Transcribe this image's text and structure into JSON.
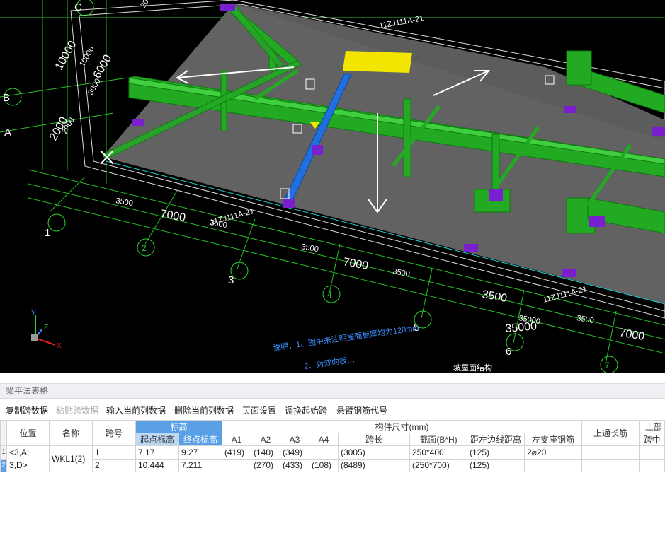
{
  "viewport": {
    "axis_letters": [
      "C",
      "B",
      "A"
    ],
    "axis_numbers": [
      "1",
      "2",
      "3",
      "4",
      "5",
      "6",
      "7"
    ],
    "dims": [
      "10000",
      "6000",
      "2000",
      "10000",
      "3000",
      "2000",
      "3500",
      "7000",
      "3500",
      "3500",
      "7000",
      "3500",
      "3500",
      "35000",
      "3500",
      "35000",
      "7000",
      "2000"
    ],
    "callouts": [
      "11ZJ111A-21",
      "11ZJ111A-21",
      "11ZJ111A-21"
    ],
    "notes": [
      "说明：1、图中未注明屋面板厚均为120mm",
      "2、对双向板…",
      "坡屋面结构…"
    ],
    "ucs": [
      "Y",
      "X",
      "Z"
    ]
  },
  "panel": {
    "title": "梁平法表格",
    "toolbar": [
      "复制跨数据",
      "粘贴跨数据",
      "输入当前列数据",
      "删除当前列数据",
      "页面设置",
      "调换起始跨",
      "悬臂钢筋代号"
    ],
    "headers": {
      "position": "位置",
      "name": "名称",
      "span_no": "跨号",
      "elevation": "标高",
      "start_elev": "起点标高",
      "end_elev": "终点标高",
      "member_size": "构件尺寸(mm)",
      "a1": "A1",
      "a2": "A2",
      "a3": "A3",
      "a4": "A4",
      "span_len": "跨长",
      "section": "截面(B*H)",
      "left_edge": "距左边线距离",
      "top_long": "上通长筋",
      "upper": "上部",
      "left_support": "左支座钢筋",
      "mid_span": "跨中"
    },
    "rows": [
      {
        "rn": "1",
        "position": "<3,A;",
        "name": "WKL1(2)",
        "span": "1",
        "start": "7.17",
        "end": "9.27",
        "a1": "(419)",
        "a2": "(140)",
        "a3": "(349)",
        "a4": "",
        "span_len": "(3005)",
        "section": "250*400",
        "left_edge": "(125)",
        "top_long": "2⌀20"
      },
      {
        "rn": "2",
        "position": "3,D>",
        "name": "",
        "span": "2",
        "start": "10.444",
        "end": "7.211",
        "a1": "",
        "a2": "(270)",
        "a3": "(433)",
        "a4": "(108)",
        "span_len": "(8489)",
        "section": "(250*700)",
        "left_edge": "(125)",
        "top_long": ""
      }
    ]
  },
  "colors": {
    "beam_green": "#22aa22",
    "beam_blue": "#1f6fe0",
    "grid_line": "#2bd42b",
    "selected_header": "#5aa0e6"
  }
}
